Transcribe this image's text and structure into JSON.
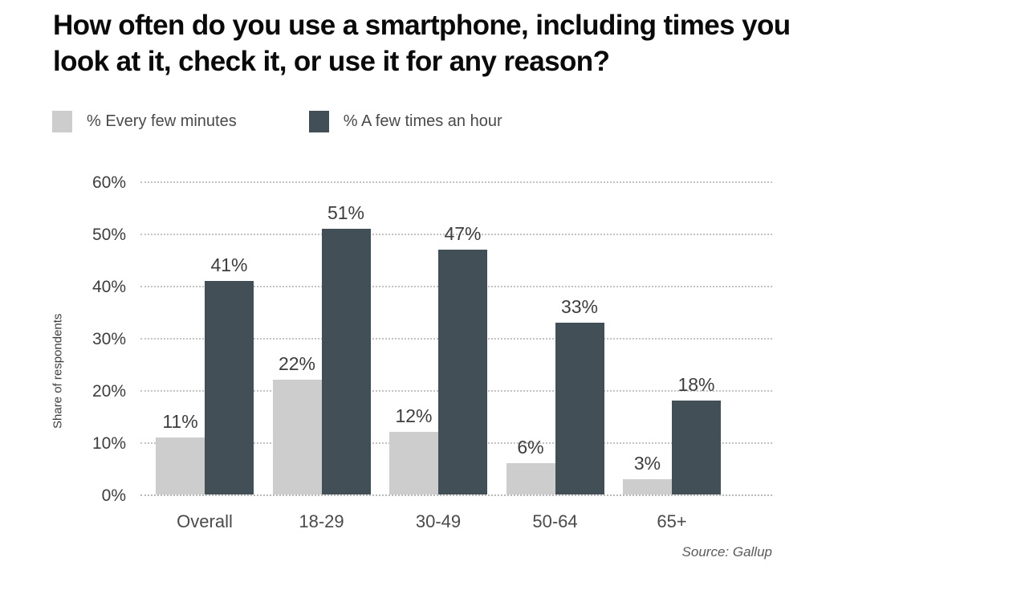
{
  "chart_data": {
    "type": "bar",
    "title": "How often do you use a smartphone, including times you\nlook at it, check it, or use it for any reason?",
    "categories": [
      "Overall",
      "18-29",
      "30-49",
      "50-64",
      "65+"
    ],
    "series": [
      {
        "name": "% Every few minutes",
        "color": "#cdcdcd",
        "values": [
          11,
          22,
          12,
          6,
          3
        ],
        "labels": [
          "11%",
          "22%",
          "12%",
          "6%",
          "3%"
        ]
      },
      {
        "name": "% A few times an hour",
        "color": "#434f57",
        "values": [
          41,
          51,
          47,
          33,
          18
        ],
        "labels": [
          "41%",
          "51%",
          "47%",
          "33%",
          "18%"
        ]
      }
    ],
    "xlabel": "",
    "ylabel": "Share of respondents",
    "ylim": [
      0,
      60
    ],
    "yticks": [
      0,
      10,
      20,
      30,
      40,
      50,
      60
    ],
    "ytick_labels": [
      "0%",
      "10%",
      "20%",
      "30%",
      "40%",
      "50%",
      "60%"
    ],
    "grid": true,
    "grid_style": "dotted-horizontal",
    "legend_position": "top-left",
    "source": "Source: Gallup",
    "background": "#ffffff"
  }
}
